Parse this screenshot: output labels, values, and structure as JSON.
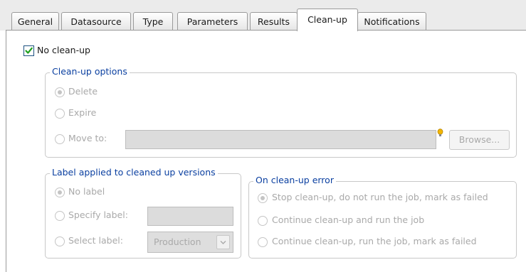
{
  "tabs": [
    "General",
    "Datasource",
    "Type",
    "Parameters",
    "Results",
    "Clean-up",
    "Notifications"
  ],
  "no_cleanup": {
    "label": "No clean-up",
    "checked": true
  },
  "cleanup_options": {
    "legend": "Clean-up options",
    "delete_label": "Delete",
    "expire_label": "Expire",
    "move_to_label": "Move to:",
    "move_to_value": "",
    "browse_label": "Browse..."
  },
  "label_group": {
    "legend": "Label applied to cleaned up versions",
    "no_label": "No label",
    "specify_label": "Specify label:",
    "specify_value": "",
    "select_label": "Select label:",
    "select_value": "Production"
  },
  "error_group": {
    "legend": "On clean-up error",
    "opt1": "Stop clean-up, do not run the job, mark as failed",
    "opt2": "Continue clean-up and run the job",
    "opt3": "Continue clean-up, run the job, mark as failed"
  },
  "colors": {
    "legend": "#0a3fa0",
    "disabled_text": "#a9a9a9",
    "checkmark": "#1fa01f",
    "hint_bulb": "#f2b600"
  },
  "icons": {
    "check": "checkmark-icon",
    "bulb": "lightbulb-icon",
    "dropdown": "chevron-down-icon"
  }
}
